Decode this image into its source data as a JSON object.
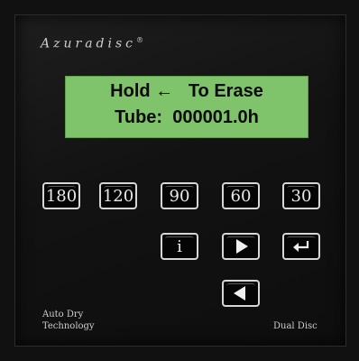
{
  "brand": {
    "name": "Azuradisc",
    "mark": "®"
  },
  "display": {
    "line1": "Hold ←   To Erase",
    "line2": "Tube:  000001.0h",
    "color": "#7fc46a"
  },
  "keys": {
    "row1": [
      "180",
      "120",
      "90",
      "60",
      "30"
    ],
    "info": "i",
    "right_icon": "right-arrow-icon",
    "enter_icon": "enter-icon",
    "left_icon": "left-arrow-icon"
  },
  "footer": {
    "left_line1": "Auto Dry",
    "left_line2": "Technology",
    "right": "Dual Disc"
  }
}
